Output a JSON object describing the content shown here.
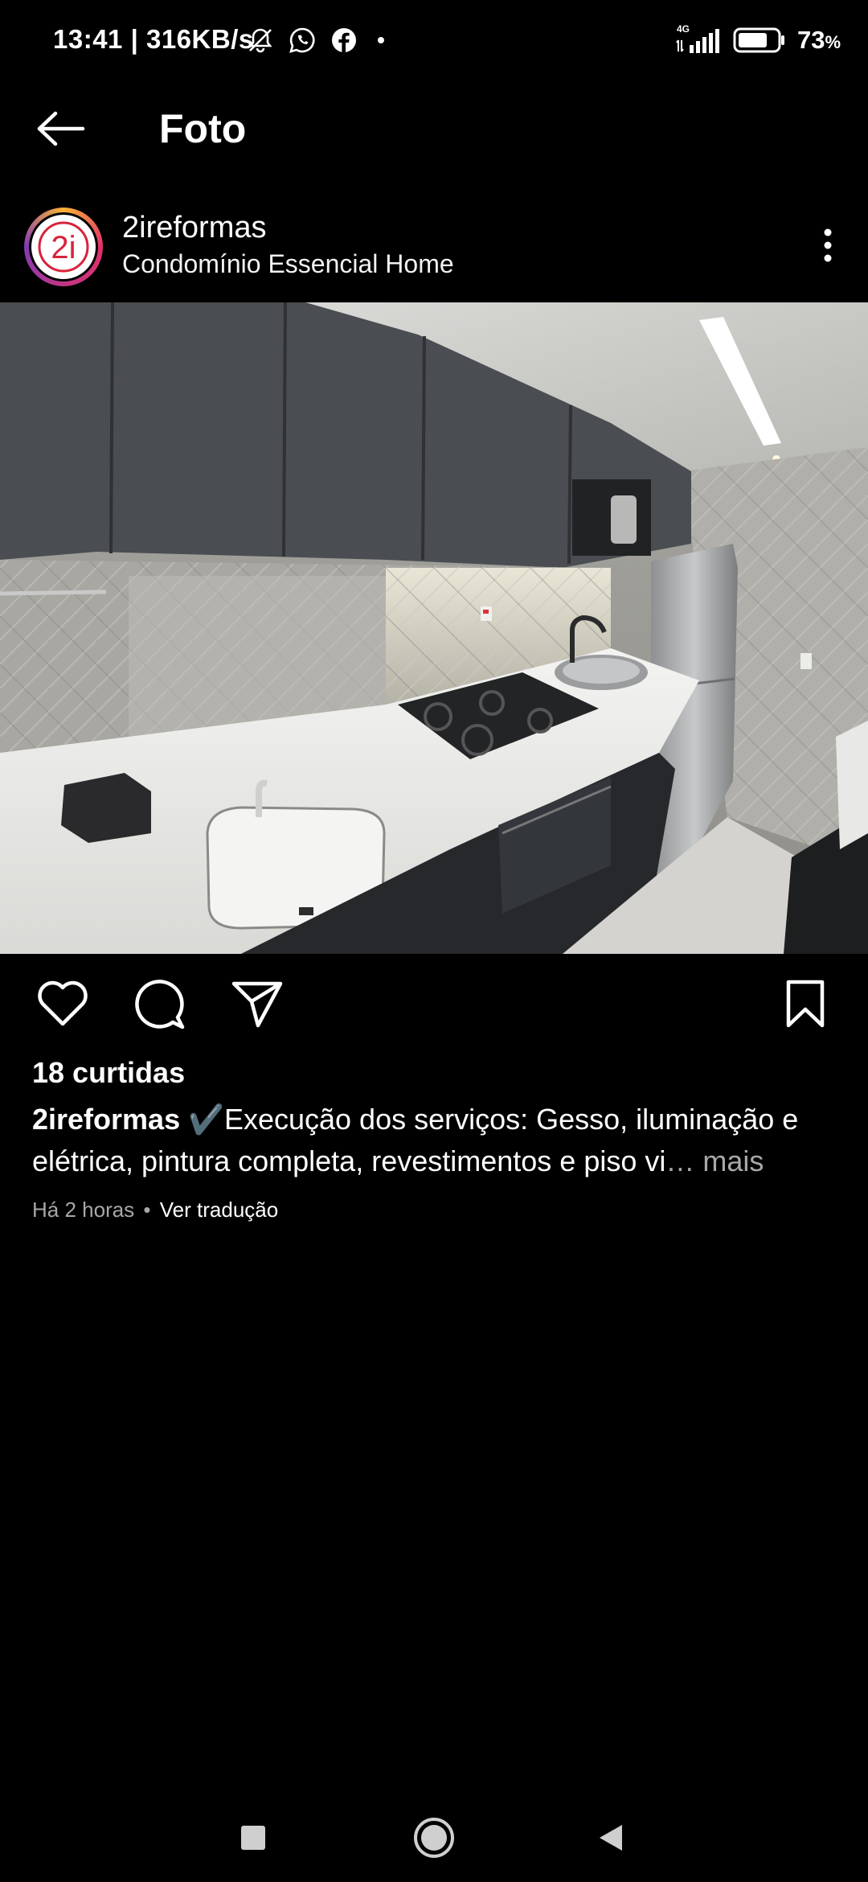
{
  "status_bar": {
    "time": "13:41",
    "speed": "| 316KB/s",
    "network": "4G",
    "battery": "73",
    "battery_unit": "%",
    "icons": [
      "mute-bell-icon",
      "whatsapp-icon",
      "facebook-icon",
      "dot-icon",
      "signal-icon",
      "battery-icon"
    ]
  },
  "app_bar": {
    "title": "Foto",
    "back_icon": "arrow-left-icon"
  },
  "post": {
    "username": "2ireformas",
    "location": "Condomínio Essencial Home",
    "avatar_text": "2i",
    "more_icon": "vertical-dots-icon",
    "likes": "18 curtidas",
    "caption_user": "2ireformas",
    "caption_text": "✔️Execução dos serviços: Gesso, iluminação e elétrica, pintura completa, revestimentos e piso vi",
    "caption_ellipsis": "… mais",
    "time_ago": "Há 2 horas",
    "separator": "•",
    "translate": "Ver tradução"
  },
  "actions": {
    "like_icon": "heart-icon",
    "comment_icon": "comment-icon",
    "share_icon": "paper-plane-icon",
    "save_icon": "bookmark-icon"
  },
  "colors": {
    "background": "#000000",
    "text": "#ffffff",
    "secondary_text": "#a8a8a8",
    "brand_red": "#d6243c"
  }
}
